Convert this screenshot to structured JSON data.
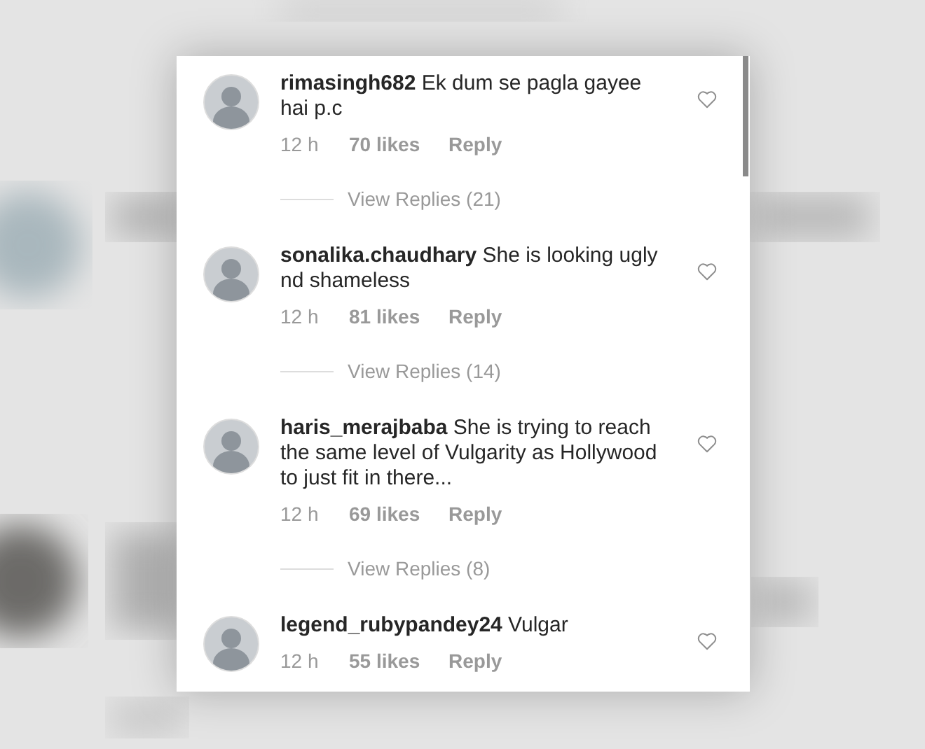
{
  "comments": [
    {
      "username": "rimasingh682",
      "text": "Ek dum se pagla gayee hai p.c",
      "time": "12 h",
      "likes": "70 likes",
      "reply": "Reply",
      "liked": false,
      "view_replies": "View Replies (21)"
    },
    {
      "username": "sonalika.chaudhary",
      "text": "She is looking ugly nd shameless",
      "time": "12 h",
      "likes": "81 likes",
      "reply": "Reply",
      "liked": false,
      "view_replies": "View Replies (14)"
    },
    {
      "username": "haris_merajbaba",
      "text": "She is trying to reach the same level of Vulgarity as Hollywood to just fit in there...",
      "time": "12 h",
      "likes": "69 likes",
      "reply": "Reply",
      "liked": false,
      "view_replies": "View Replies (8)"
    },
    {
      "username": "legend_rubypandey24",
      "text": "Vulgar",
      "time": "12 h",
      "likes": "55 likes",
      "reply": "Reply",
      "liked": false
    }
  ]
}
